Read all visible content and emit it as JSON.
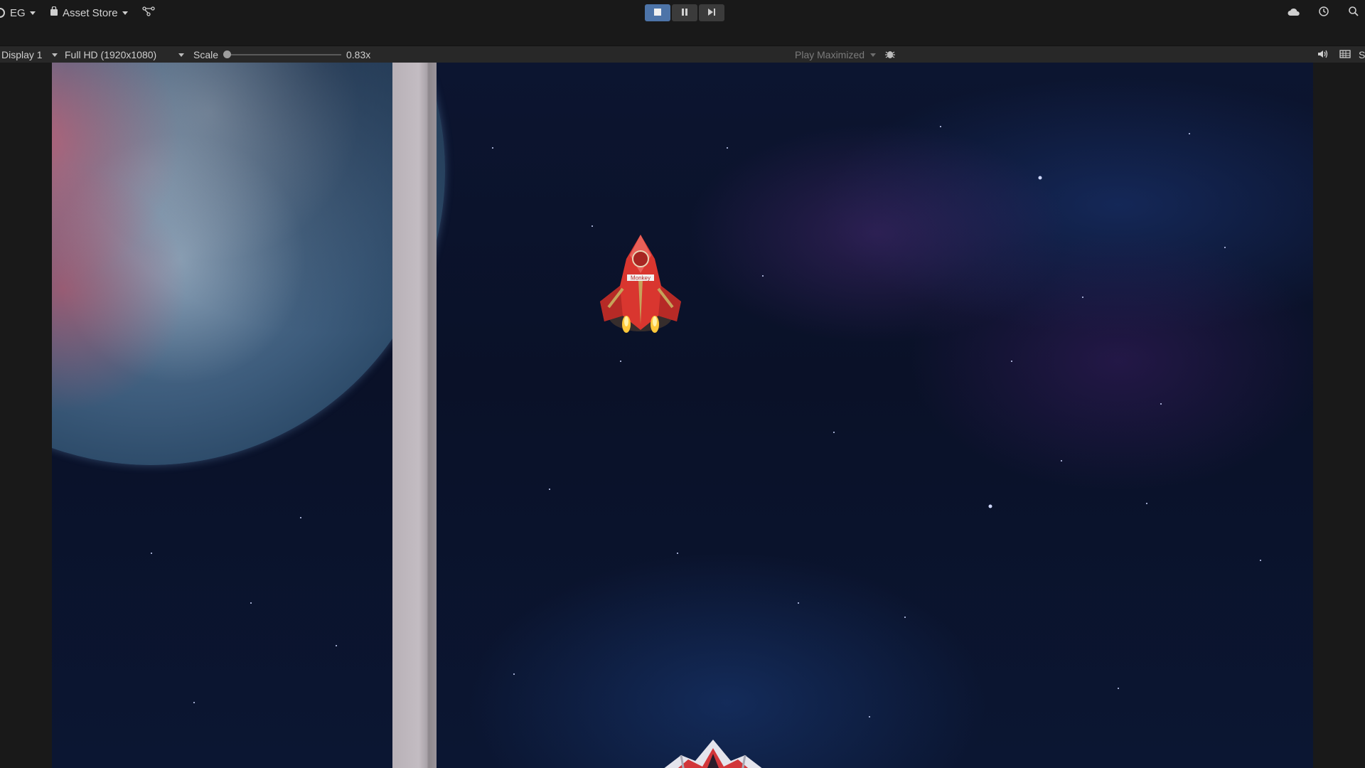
{
  "toolbar": {
    "account_label": "EG",
    "asset_store_label": "Asset Store",
    "icons": [
      "account-icon",
      "shopping-bag-icon",
      "version-control-icon",
      "cloud-icon",
      "history-icon",
      "search-icon"
    ],
    "play_controls": [
      "stop-icon",
      "pause-icon",
      "step-icon"
    ],
    "active_control": "stop",
    "colors": {
      "background": "#191919",
      "active_play": "#4d74a8",
      "button": "#3b3b3b"
    }
  },
  "game_view": {
    "display_label": "Display 1",
    "resolution_label": "Full HD (1920x1080)",
    "scale_label": "Scale",
    "scale_value_label": "0.83x",
    "scale_value": 0.83,
    "play_mode_label": "Play Maximized",
    "right_icons": [
      "debug-bug-icon",
      "audio-icon",
      "stats-icon"
    ],
    "right_edge_label": "S"
  },
  "scene": {
    "elements": [
      "space-background",
      "planet",
      "divider-wall",
      "player-ship",
      "enemy-ship"
    ],
    "ship_decal": "Monkey"
  }
}
